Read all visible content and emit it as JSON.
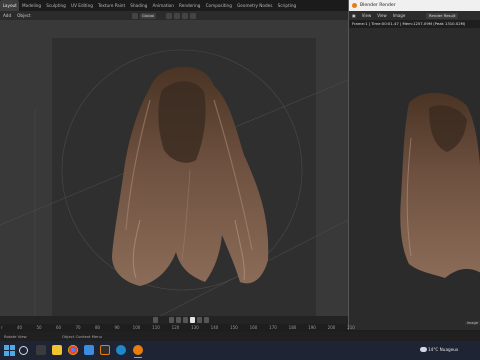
{
  "workspace_tabs": [
    "Layout",
    "Modeling",
    "Sculpting",
    "UV Editing",
    "Texture Paint",
    "Shading",
    "Animation",
    "Rendering",
    "Compositing",
    "Geometry Nodes",
    "Scripting"
  ],
  "active_tab_index": 0,
  "header": {
    "add": "Add",
    "object": "Object",
    "orientation": "Global"
  },
  "render_window": {
    "title": "Blender Render",
    "menu_view": "View",
    "menu_view2": "View",
    "menu_image": "Image",
    "slot": "Render Result",
    "stats": "Frame:1 | Time:00:01.47 | Mem:1257.09M (Peak 1310.02M)",
    "zoom": "Image"
  },
  "timeline": {
    "ticks": [
      "40",
      "50",
      "60",
      "70",
      "80",
      "90",
      "100",
      "110",
      "120",
      "130",
      "140",
      "150",
      "160",
      "170",
      "180",
      "190",
      "200",
      "210"
    ],
    "current_frame": "1",
    "left_label": "r"
  },
  "status": {
    "left": "Rotate View",
    "mid": "Object Context Menu"
  },
  "taskbar": {
    "weather": "14°C  Nuageux"
  },
  "colors": {
    "accent": "#3e72c6",
    "blender_orange": "#e87d0d",
    "hair_base": "#6b4a33",
    "hair_highlight": "#b99a82"
  }
}
